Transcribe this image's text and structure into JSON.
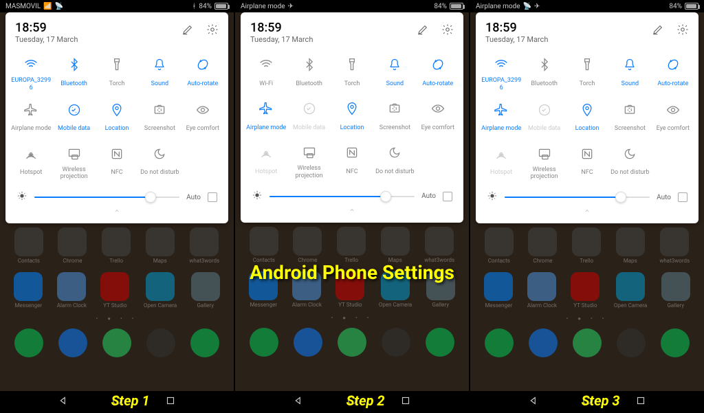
{
  "title": "Android Phone Settings",
  "steps": [
    {
      "key": "step1",
      "label": "Step 1",
      "status": {
        "carrier": "MASMOVIL",
        "signal": true,
        "wifi": true,
        "bt": true,
        "battery_pct": "84%",
        "battery_fill": 84
      },
      "header": {
        "time": "18:59",
        "date": "Tuesday, 17 March"
      },
      "tiles": [
        {
          "icon": "wifi",
          "label": "EUROPA_3299 6",
          "state": "active"
        },
        {
          "icon": "bluetooth",
          "label": "Bluetooth",
          "state": "active"
        },
        {
          "icon": "torch",
          "label": "Torch",
          "state": "inactive"
        },
        {
          "icon": "sound",
          "label": "Sound",
          "state": "active"
        },
        {
          "icon": "rotate",
          "label": "Auto-rotate",
          "state": "active"
        },
        {
          "icon": "airplane",
          "label": "Airplane mode",
          "state": "inactive"
        },
        {
          "icon": "data",
          "label": "Mobile data",
          "state": "active"
        },
        {
          "icon": "location",
          "label": "Location",
          "state": "active"
        },
        {
          "icon": "screenshot",
          "label": "Screenshot",
          "state": "inactive"
        },
        {
          "icon": "eye",
          "label": "Eye comfort",
          "state": "inactive"
        },
        {
          "icon": "hotspot",
          "label": "Hotspot",
          "state": "inactive"
        },
        {
          "icon": "cast",
          "label": "Wireless projection",
          "state": "inactive"
        },
        {
          "icon": "nfc",
          "label": "NFC",
          "state": "inactive"
        },
        {
          "icon": "dnd",
          "label": "Do not disturb",
          "state": "inactive"
        }
      ],
      "brightness": {
        "value": 80,
        "auto_label": "Auto",
        "auto_checked": false
      }
    },
    {
      "key": "step2",
      "label": "Step 2",
      "status": {
        "carrier": "Airplane mode",
        "airplane": true,
        "battery_pct": "84%",
        "battery_fill": 84
      },
      "header": {
        "time": "18:59",
        "date": "Tuesday, 17 March"
      },
      "tiles": [
        {
          "icon": "wifi",
          "label": "Wi-Fi",
          "state": "inactive"
        },
        {
          "icon": "bluetooth",
          "label": "Bluetooth",
          "state": "inactive"
        },
        {
          "icon": "torch",
          "label": "Torch",
          "state": "inactive"
        },
        {
          "icon": "sound",
          "label": "Sound",
          "state": "active"
        },
        {
          "icon": "rotate",
          "label": "Auto-rotate",
          "state": "active"
        },
        {
          "icon": "airplane",
          "label": "Airplane mode",
          "state": "active"
        },
        {
          "icon": "data",
          "label": "Mobile data",
          "state": "disabled"
        },
        {
          "icon": "location",
          "label": "Location",
          "state": "active"
        },
        {
          "icon": "screenshot",
          "label": "Screenshot",
          "state": "inactive"
        },
        {
          "icon": "eye",
          "label": "Eye comfort",
          "state": "inactive"
        },
        {
          "icon": "hotspot",
          "label": "Hotspot",
          "state": "disabled"
        },
        {
          "icon": "cast",
          "label": "Wireless projection",
          "state": "inactive"
        },
        {
          "icon": "nfc",
          "label": "NFC",
          "state": "inactive"
        },
        {
          "icon": "dnd",
          "label": "Do not disturb",
          "state": "inactive"
        }
      ],
      "brightness": {
        "value": 80,
        "auto_label": "Auto",
        "auto_checked": false
      }
    },
    {
      "key": "step3",
      "label": "Step 3",
      "status": {
        "carrier": "Airplane mode",
        "wifi": true,
        "airplane": true,
        "battery_pct": "84%",
        "battery_fill": 84
      },
      "header": {
        "time": "18:59",
        "date": "Tuesday, 17 March"
      },
      "tiles": [
        {
          "icon": "wifi",
          "label": "EUROPA_3299 6",
          "state": "active"
        },
        {
          "icon": "bluetooth",
          "label": "Bluetooth",
          "state": "inactive"
        },
        {
          "icon": "torch",
          "label": "Torch",
          "state": "inactive"
        },
        {
          "icon": "sound",
          "label": "Sound",
          "state": "active"
        },
        {
          "icon": "rotate",
          "label": "Auto-rotate",
          "state": "active"
        },
        {
          "icon": "airplane",
          "label": "Airplane mode",
          "state": "active"
        },
        {
          "icon": "data",
          "label": "Mobile data",
          "state": "disabled"
        },
        {
          "icon": "location",
          "label": "Location",
          "state": "active"
        },
        {
          "icon": "screenshot",
          "label": "Screenshot",
          "state": "inactive"
        },
        {
          "icon": "eye",
          "label": "Eye comfort",
          "state": "inactive"
        },
        {
          "icon": "hotspot",
          "label": "Hotspot",
          "state": "disabled"
        },
        {
          "icon": "cast",
          "label": "Wireless projection",
          "state": "inactive"
        },
        {
          "icon": "nfc",
          "label": "NFC",
          "state": "inactive"
        },
        {
          "icon": "dnd",
          "label": "Do not disturb",
          "state": "inactive"
        }
      ],
      "brightness": {
        "value": 80,
        "auto_label": "Auto",
        "auto_checked": false
      }
    }
  ],
  "home_apps_row1": [
    "Contacts",
    "Chrome",
    "Trello",
    "Maps",
    "what3words"
  ],
  "home_apps_row2": [
    "Messenger",
    "Alarm Clock",
    "YT Studio",
    "Open Camera",
    "Gallery"
  ],
  "app_colors_row2": [
    "#0084ff",
    "#4a90d9",
    "#cc0000",
    "#0099cc",
    "#5a7a8a"
  ],
  "dock_colors": [
    "#00c853",
    "#0a7cff",
    "#25d366",
    "#333",
    "#00c853"
  ]
}
